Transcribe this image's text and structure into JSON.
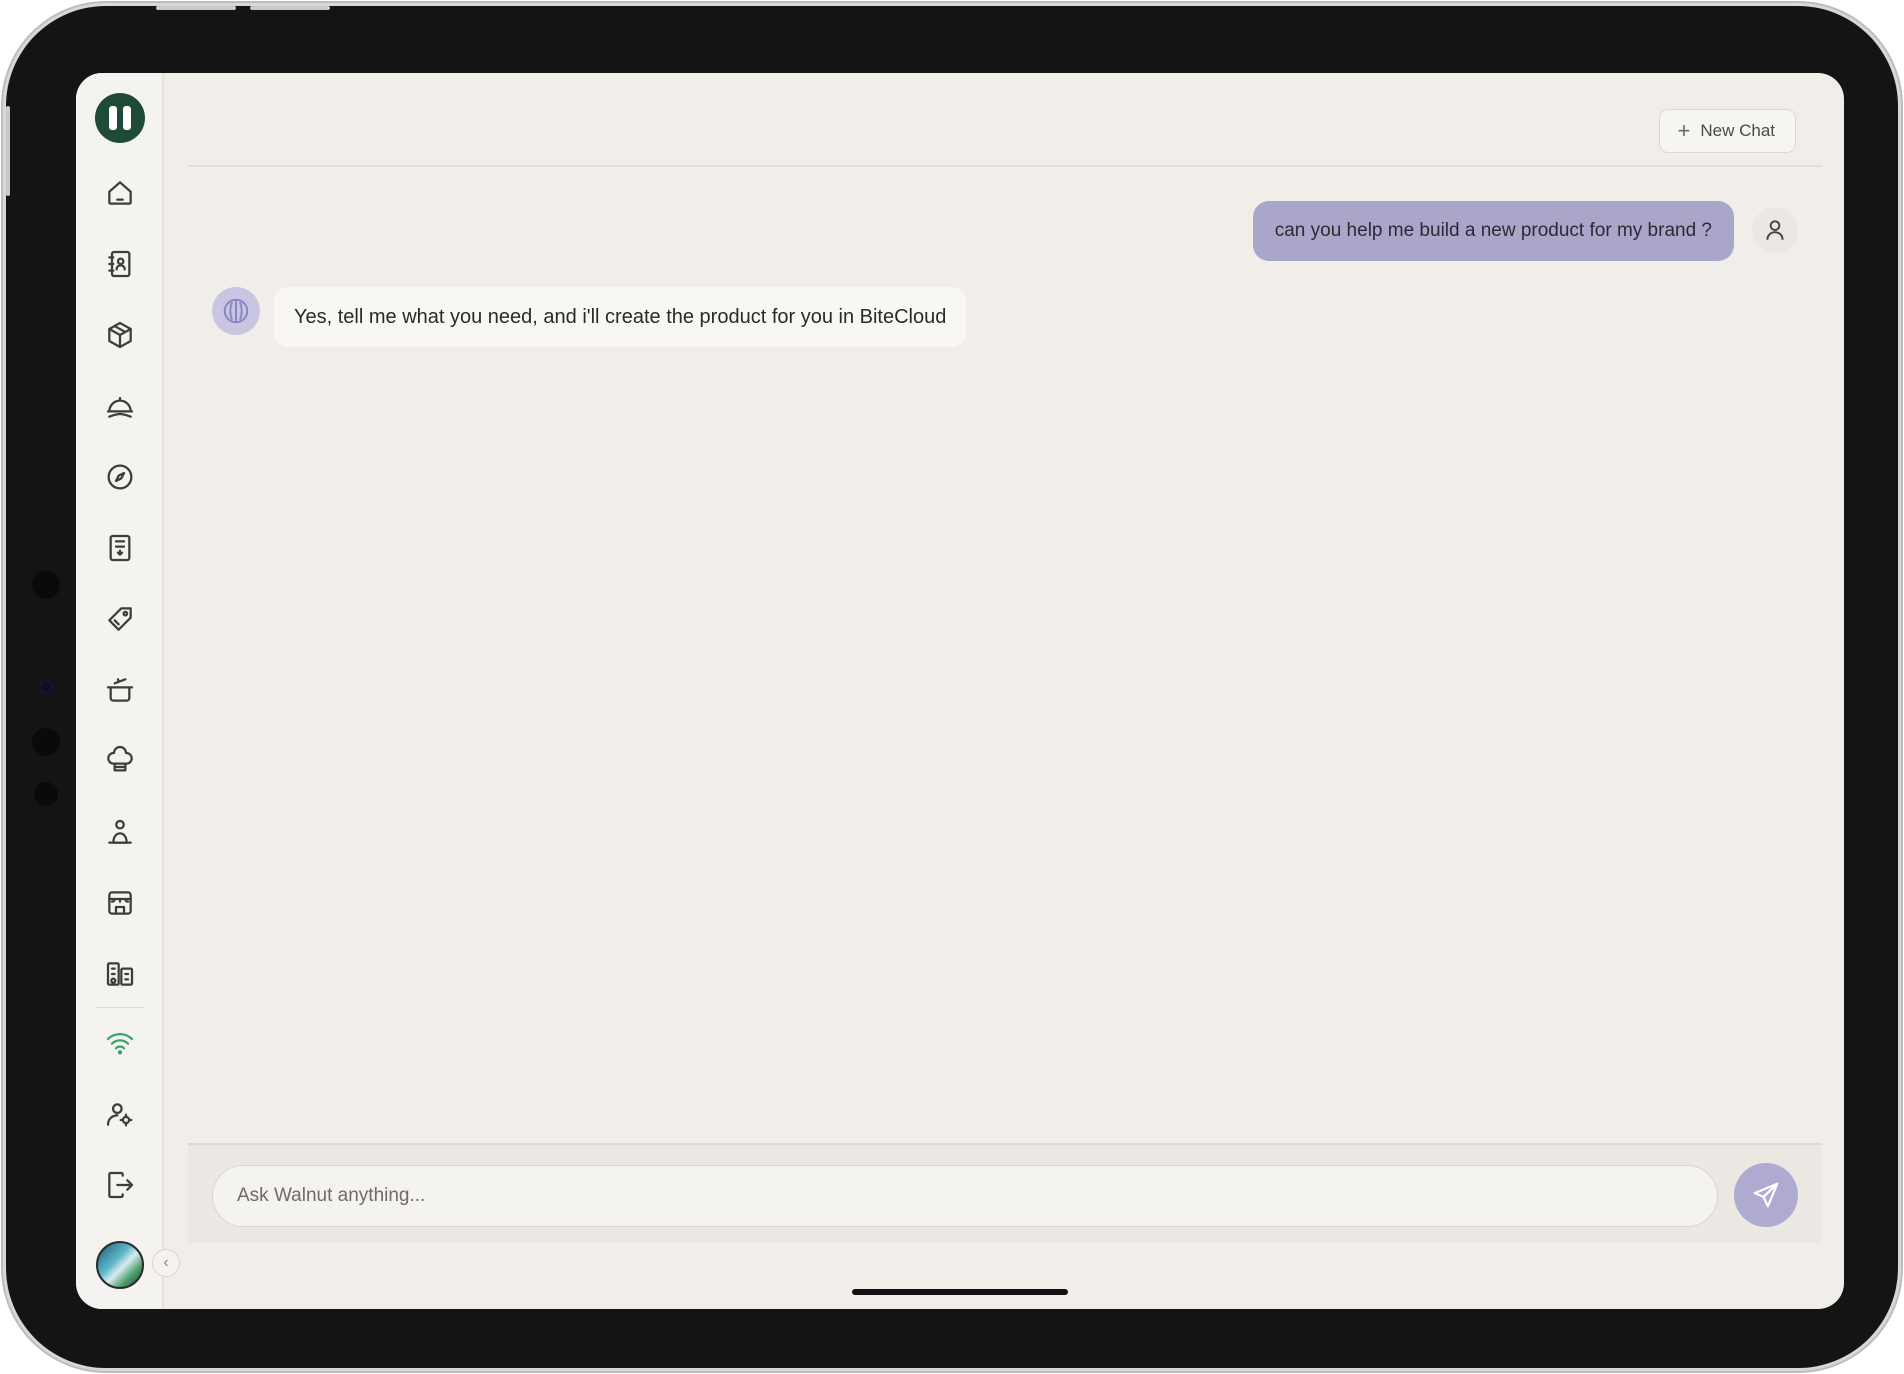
{
  "header": {
    "new_chat_label": "New Chat"
  },
  "conversation": {
    "messages": [
      {
        "role": "user",
        "text": "can you help me build a new product for my brand ?"
      },
      {
        "role": "assistant",
        "text": "Yes, tell me what you need, and i'll create the product for you in BiteCloud"
      }
    ]
  },
  "composer": {
    "placeholder": "Ask Walnut anything..."
  },
  "sidebar": {
    "icons": [
      "home-icon",
      "contacts-icon",
      "package-icon",
      "serving-cloche-icon",
      "compass-icon",
      "document-icon",
      "tag-icon",
      "cooking-pot-icon",
      "chef-hat-icon",
      "person-icon",
      "storefront-icon",
      "buildings-icon",
      "wifi-icon",
      "settings-person-icon",
      "logout-icon"
    ]
  },
  "colors": {
    "brand": "#1e4a37",
    "user_bubble": "#a9a6c9",
    "send_button": "#aeaad0",
    "background": "#f1eee9",
    "wifi": "#3aa56b"
  }
}
